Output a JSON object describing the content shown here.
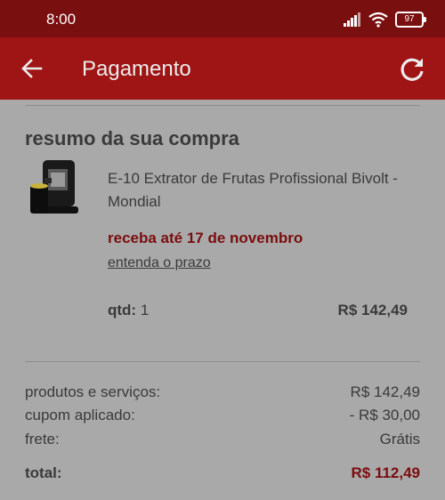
{
  "status_bar": {
    "time": "8:00",
    "battery": "97"
  },
  "appbar": {
    "title": "Pagamento",
    "back_icon": "arrow-left-icon",
    "refresh_icon": "refresh-icon"
  },
  "summary": {
    "title": "resumo da sua compra",
    "product": {
      "name": "E-10 Extrator de Frutas Profissional Bivolt - Mondial",
      "delivery": "receba até 17 de novembro",
      "prazo_link": "entenda o prazo",
      "qty_label": "qtd:",
      "qty_value": "1",
      "price": "R$ 142,49"
    },
    "rows": {
      "products_label": "produtos e serviços:",
      "products_value": "R$ 142,49",
      "coupon_label": "cupom aplicado:",
      "coupon_value": "- R$ 30,00",
      "shipping_label": "frete:",
      "shipping_value": "Grátis",
      "total_label": "total:",
      "total_value": "R$ 112,49"
    }
  },
  "colors": {
    "status_bar": "#7a0f0f",
    "app_bar": "#9f1414",
    "background": "#a9a9a9",
    "accent_text": "#7b0d0d"
  }
}
